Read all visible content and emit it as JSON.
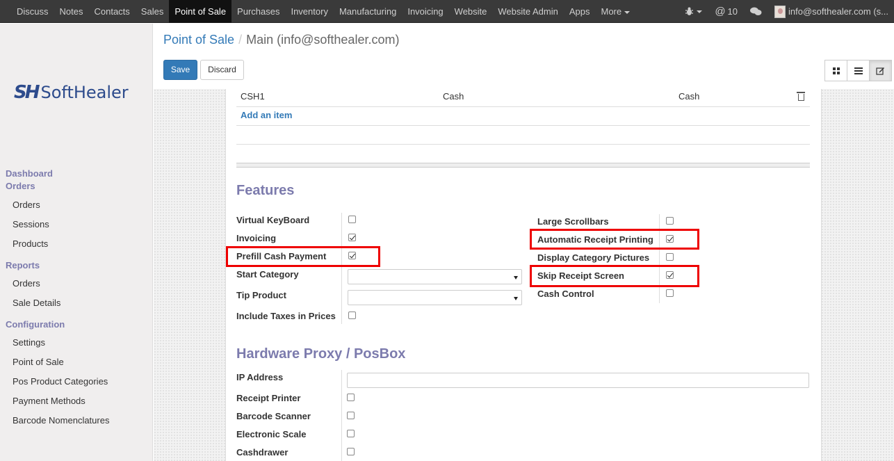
{
  "topnav": {
    "items": [
      "Discuss",
      "Notes",
      "Contacts",
      "Sales",
      "Point of Sale",
      "Purchases",
      "Inventory",
      "Manufacturing",
      "Invoicing",
      "Website",
      "Website Admin",
      "Apps",
      "More"
    ],
    "active": "Point of Sale",
    "mentions_count": "10",
    "user": "info@softhealer.com (s..."
  },
  "logo": {
    "mark": "SH",
    "text": "SoftHealer"
  },
  "sidebar": {
    "dashboard": "Dashboard",
    "orders_section": "Orders",
    "orders_items": [
      "Orders",
      "Sessions",
      "Products"
    ],
    "reports_section": "Reports",
    "reports_items": [
      "Orders",
      "Sale Details"
    ],
    "config_section": "Configuration",
    "config_items": [
      "Settings",
      "Point of Sale",
      "Pos Product Categories",
      "Payment Methods",
      "Barcode Nomenclatures"
    ]
  },
  "breadcrumb": {
    "parent": "Point of Sale",
    "separator": "/",
    "current": "Main (info@softhealer.com)"
  },
  "toolbar": {
    "save_label": "Save",
    "discard_label": "Discard"
  },
  "journal_row": {
    "name": "CSH1",
    "type": "Cash",
    "method": "Cash"
  },
  "add_item_label": "Add an item",
  "features": {
    "title": "Features",
    "left": [
      {
        "label": "Virtual KeyBoard",
        "checked": false
      },
      {
        "label": "Invoicing",
        "checked": true
      },
      {
        "label": "Prefill Cash Payment",
        "checked": true
      }
    ],
    "start_category_label": "Start Category",
    "tip_product_label": "Tip Product",
    "include_taxes_label": "Include Taxes in Prices",
    "include_taxes_checked": false,
    "right": [
      {
        "label": "Large Scrollbars",
        "checked": false
      },
      {
        "label": "Automatic Receipt Printing",
        "checked": true
      },
      {
        "label": "Display Category Pictures",
        "checked": false
      },
      {
        "label": "Skip Receipt Screen",
        "checked": true
      },
      {
        "label": "Cash Control",
        "checked": false
      }
    ]
  },
  "hardware": {
    "title": "Hardware Proxy / PosBox",
    "ip_label": "IP Address",
    "ip_value": "",
    "items": [
      {
        "label": "Receipt Printer",
        "checked": false
      },
      {
        "label": "Barcode Scanner",
        "checked": false
      },
      {
        "label": "Electronic Scale",
        "checked": false
      },
      {
        "label": "Cashdrawer",
        "checked": false
      }
    ]
  },
  "colors": {
    "accent": "#7c7bad",
    "primary": "#337ab7",
    "highlight": "#e00000",
    "topbar": "#3a3a3a"
  }
}
